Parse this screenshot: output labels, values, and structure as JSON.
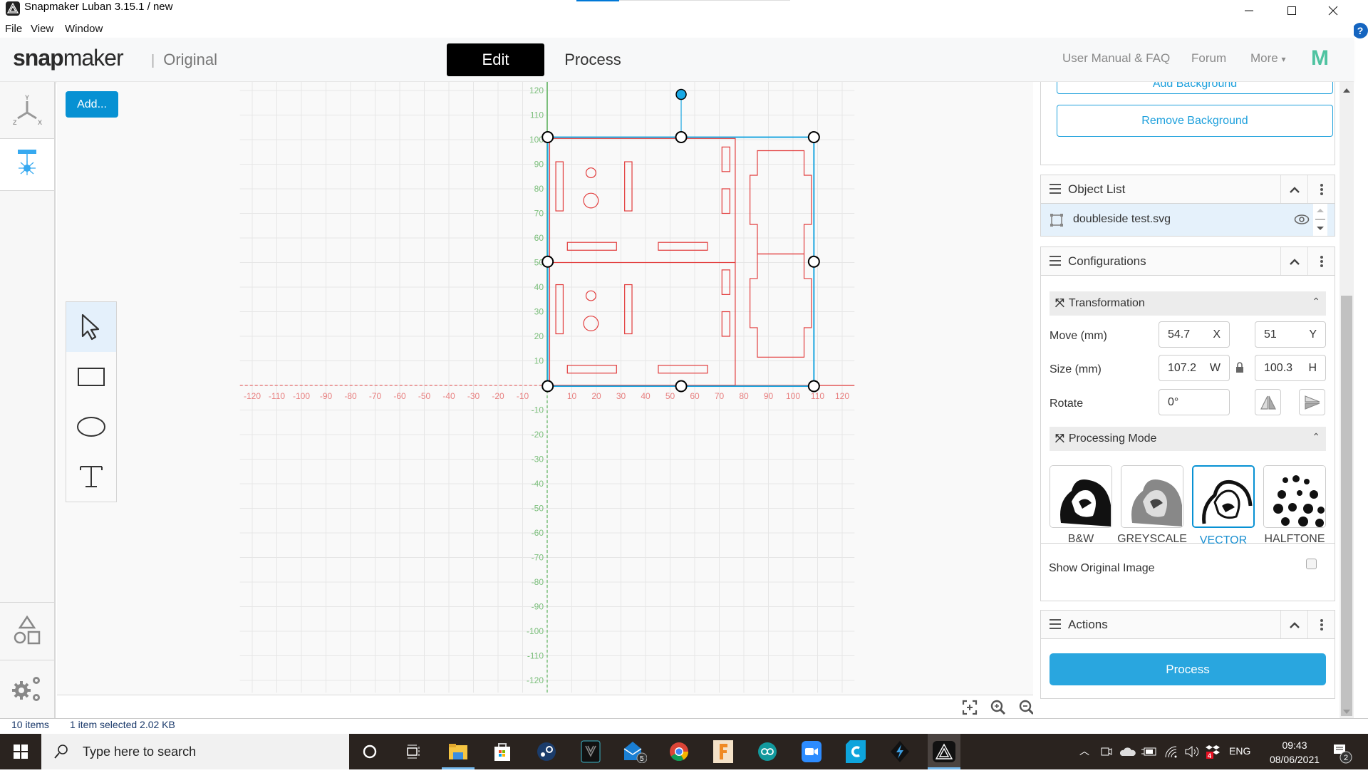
{
  "window": {
    "title": "Snapmaker Luban 3.15.1 / new",
    "minimize_icon": "minimize-icon",
    "maximize_icon": "maximize-icon",
    "close_icon": "close-icon"
  },
  "menubar": [
    "File",
    "View",
    "Window"
  ],
  "header": {
    "logo_bold": "snap",
    "logo_light": "maker",
    "series": "Original",
    "tabs": [
      {
        "label": "Edit",
        "active": true
      },
      {
        "label": "Process",
        "active": false
      }
    ],
    "links": [
      "User Manual & FAQ",
      "Forum",
      "More"
    ],
    "more_caret": "▾",
    "brand_mark": "M"
  },
  "sidebar": {
    "items": [
      {
        "name": "axis-view",
        "icon": "xyz-axes-icon",
        "labels": {
          "x": "X",
          "y": "Y",
          "z": "Z"
        }
      },
      {
        "name": "laser-tool",
        "icon": "laser-icon",
        "active": true
      },
      {
        "name": "models",
        "icon": "shapes-icon"
      },
      {
        "name": "settings",
        "icon": "gears-icon"
      }
    ]
  },
  "canvas": {
    "add_button": "Add...",
    "tools": [
      {
        "name": "select",
        "icon": "cursor-icon",
        "active": true
      },
      {
        "name": "rectangle",
        "icon": "rectangle-icon"
      },
      {
        "name": "ellipse",
        "icon": "ellipse-icon"
      },
      {
        "name": "text",
        "icon": "text-icon"
      }
    ],
    "x_ticks": [
      -120,
      -110,
      -100,
      -90,
      -80,
      -70,
      -60,
      -50,
      -40,
      -30,
      -20,
      -10,
      10,
      20,
      30,
      40,
      50,
      60,
      70,
      80,
      90,
      100,
      110,
      120
    ],
    "y_ticks": [
      120,
      110,
      100,
      90,
      80,
      70,
      60,
      50,
      40,
      30,
      20,
      10,
      -10,
      -20,
      -30,
      -40,
      -50,
      -60,
      -70,
      -80,
      -90,
      -100,
      -110,
      -120
    ],
    "axis_colors": {
      "x": "#e88080",
      "y": "#7cbf7c"
    },
    "selection_color": "#1ea7e0",
    "shape_color": "#e23b3b",
    "zoom_controls": [
      "fit-to-view-icon",
      "zoom-in-icon",
      "zoom-out-icon"
    ]
  },
  "right_panel": {
    "background_buttons": [
      "Add Background",
      "Remove Background"
    ],
    "object_list": {
      "title": "Object List",
      "items": [
        {
          "name": "doubleside test.svg",
          "visible": true
        }
      ]
    },
    "configurations": {
      "title": "Configurations",
      "transformation": {
        "title": "Transformation",
        "move_label": "Move (mm)",
        "move_x": "54.7",
        "move_x_unit": "X",
        "move_y": "51",
        "move_y_unit": "Y",
        "size_label": "Size (mm)",
        "size_w": "107.2",
        "size_w_unit": "W",
        "size_h": "100.3",
        "size_h_unit": "H",
        "rotate_label": "Rotate",
        "rotate": "0°"
      },
      "processing_mode": {
        "title": "Processing Mode",
        "modes": [
          {
            "label": "B&W",
            "selected": false
          },
          {
            "label": "GREYSCALE",
            "selected": false
          },
          {
            "label": "VECTOR",
            "selected": true
          },
          {
            "label": "HALFTONE",
            "selected": false
          }
        ],
        "show_original_label": "Show Original Image",
        "show_original": false
      }
    },
    "actions": {
      "title": "Actions",
      "process_button": "Process"
    },
    "accent": "#29a6df"
  },
  "explorer_status": {
    "items": "10 items",
    "selected": "1 item selected  2.02 KB"
  },
  "taskbar": {
    "search_placeholder": "Type here to search",
    "pinned": [
      "cortana",
      "task-view",
      "file-explorer",
      "microsoft-store",
      "steam",
      "predator-sense",
      "mail",
      "chrome",
      "fusion-360",
      "arduino",
      "zoom",
      "cura",
      "lightburn",
      "snapmaker-luban"
    ],
    "mail_badge": "5",
    "tray_badge": "4",
    "language": "ENG",
    "time": "09:43",
    "date": "08/06/2021",
    "notifications": "2"
  }
}
